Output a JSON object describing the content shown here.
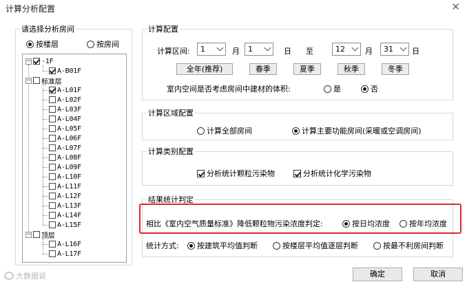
{
  "window": {
    "title": "计算分析配置",
    "close_symbol": "✕"
  },
  "left": {
    "legend": "请选择分析房间",
    "mode_options": [
      {
        "label": "按楼层",
        "selected": true
      },
      {
        "label": "按房间",
        "selected": false
      }
    ],
    "tree": [
      {
        "label": "-1F",
        "level": 0,
        "expander": "−",
        "checked": true
      },
      {
        "label": "A-B01F",
        "level": 1,
        "checked": true
      },
      {
        "label": "标准层",
        "level": 0,
        "expander": "−",
        "checked": false
      },
      {
        "label": "A-L01F",
        "level": 1,
        "checked": true
      },
      {
        "label": "A-L02F",
        "level": 1,
        "checked": false
      },
      {
        "label": "A-L03F",
        "level": 1,
        "checked": false
      },
      {
        "label": "A-L04F",
        "level": 1,
        "checked": false
      },
      {
        "label": "A-L05F",
        "level": 1,
        "checked": false
      },
      {
        "label": "A-L06F",
        "level": 1,
        "checked": false
      },
      {
        "label": "A-L07F",
        "level": 1,
        "checked": false
      },
      {
        "label": "A-L08F",
        "level": 1,
        "checked": false
      },
      {
        "label": "A-L09F",
        "level": 1,
        "checked": false
      },
      {
        "label": "A-L10F",
        "level": 1,
        "checked": false
      },
      {
        "label": "A-L11F",
        "level": 1,
        "checked": false
      },
      {
        "label": "A-L12F",
        "level": 1,
        "checked": false
      },
      {
        "label": "A-L13F",
        "level": 1,
        "checked": false
      },
      {
        "label": "A-L14F",
        "level": 1,
        "checked": false
      },
      {
        "label": "A-L15F",
        "level": 1,
        "checked": false
      },
      {
        "label": "顶层",
        "level": 0,
        "expander": "−",
        "checked": false
      },
      {
        "label": "A-L16F",
        "level": 1,
        "checked": false
      },
      {
        "label": "A-L17F",
        "level": 1,
        "checked": false
      }
    ]
  },
  "calc_config": {
    "legend": "计算配置",
    "range_label": "计算区间:",
    "start_month": "1",
    "month_label": "月",
    "start_day": "1",
    "day_label": "日",
    "to_label": "至",
    "end_month": "12",
    "end_day": "31",
    "seasons": [
      "全年(推荐)",
      "春季",
      "夏季",
      "秋季",
      "冬季"
    ],
    "question": "室内空间是否考虑房间中建材的体积:",
    "yes_label": "是",
    "no_label": "否",
    "answer": "no"
  },
  "area_config": {
    "legend": "计算区域配置",
    "options": [
      {
        "label": "计算全部房间",
        "selected": false
      },
      {
        "label": "计算主要功能房间(采暖或空调房间)",
        "selected": true
      }
    ]
  },
  "type_config": {
    "legend": "计算类别配置",
    "options": [
      {
        "label": "分析统计颗粒污染物",
        "checked": true
      },
      {
        "label": "分析统计化学污染物",
        "checked": true
      }
    ]
  },
  "result_config": {
    "legend": "结果统计判定",
    "criterion_label": "相比《室内空气质量标准》降低颗粒物污染浓度判定:",
    "criterion_options": [
      {
        "label": "按日均浓度",
        "selected": true
      },
      {
        "label": "按年均浓度",
        "selected": false
      }
    ],
    "method_label": "统计方式:",
    "method_options": [
      {
        "label": "按建筑平均值判断",
        "selected": true
      },
      {
        "label": "按楼层平均值逐层判断",
        "selected": false
      },
      {
        "label": "按最不利房间判断",
        "selected": false
      }
    ]
  },
  "buttons": {
    "ok": "确定",
    "cancel": "取消"
  },
  "watermark": "大数据说",
  "colors": {
    "highlight_border": "#e0282a"
  }
}
